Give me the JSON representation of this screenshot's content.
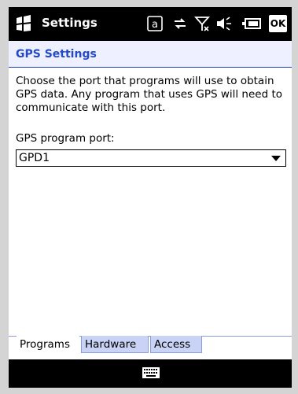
{
  "titlebar": {
    "title": "Settings",
    "ok_label": "OK",
    "icons": [
      "start-icon",
      "input-method-icon",
      "connectivity-icon",
      "signal-off-icon",
      "volume-icon",
      "battery-icon"
    ],
    "input_glyph": "a"
  },
  "header": {
    "title": "GPS Settings"
  },
  "main": {
    "description": "Choose the port that programs will use to obtain GPS data. Any program that uses GPS will need to communicate with this port.",
    "port_label": "GPS program port:",
    "port_value": "GPD1"
  },
  "tabs": [
    {
      "label": "Programs",
      "active": true
    },
    {
      "label": "Hardware",
      "active": false
    },
    {
      "label": "Access",
      "active": false
    }
  ],
  "bottombar": {
    "keyboard_icon": "keyboard-icon"
  },
  "colors": {
    "accent": "#2349c9",
    "header_bg": "#eef0ff",
    "tab_inactive": "#c9d3f5"
  }
}
